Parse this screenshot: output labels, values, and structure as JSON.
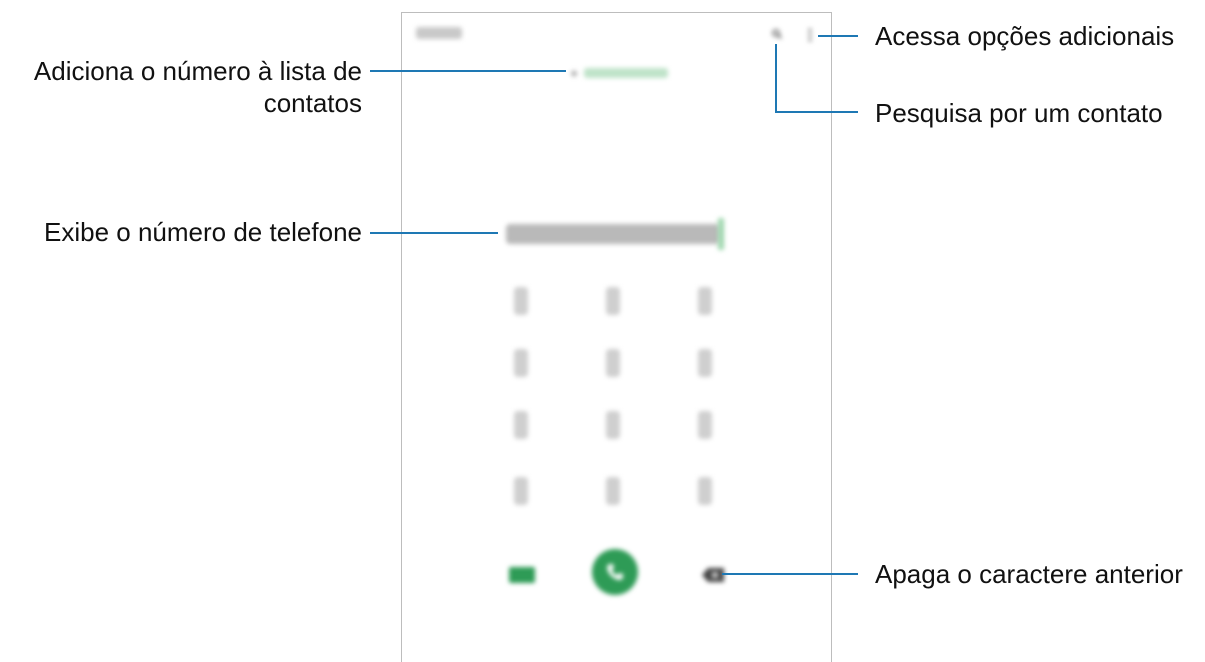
{
  "callouts": {
    "more_options": "Acessa opções adicionais",
    "search": "Pesquisa por um contato",
    "add_contact_line1": "Adiciona o número à lista de",
    "add_contact_line2": "contatos",
    "phone_number": "Exibe o número de telefone",
    "backspace": "Apaga o caractere anterior"
  },
  "phone": {
    "add_icon": "+",
    "icons": {
      "search": "search-icon",
      "more": "more-options-icon",
      "video": "video-call-icon",
      "call": "phone-call-icon",
      "backspace": "backspace-icon"
    }
  },
  "colors": {
    "callout_line": "#1e78b4",
    "call_green": "#2e9b56",
    "accent_light_green": "#bfe3c9"
  }
}
